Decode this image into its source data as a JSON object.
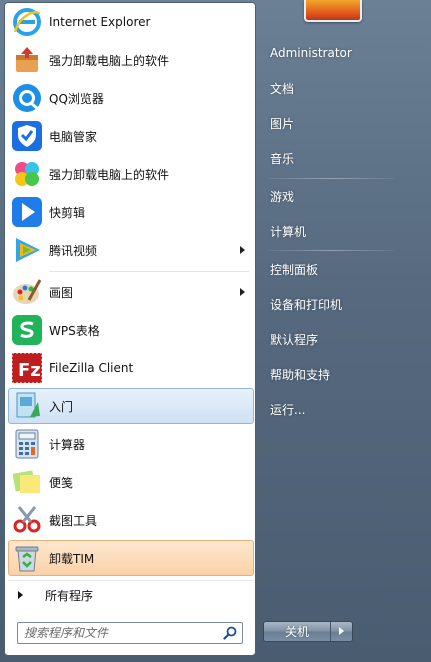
{
  "programs": [
    {
      "label": "Internet Explorer",
      "icon": "internet-explorer-icon",
      "name": "internet-explorer",
      "arrow": false,
      "highlight": ""
    },
    {
      "label": "强力卸载电脑上的软件",
      "icon": "uninstall-box-icon",
      "name": "uninstaller-1",
      "arrow": false,
      "highlight": ""
    },
    {
      "label": "QQ浏览器",
      "icon": "qq-browser-icon",
      "name": "qq-browser",
      "arrow": false,
      "highlight": ""
    },
    {
      "label": "电脑管家",
      "icon": "pc-manager-shield-icon",
      "name": "pc-manager",
      "arrow": false,
      "highlight": ""
    },
    {
      "label": "强力卸载电脑上的软件",
      "icon": "uninstall-flower-icon",
      "name": "uninstaller-2",
      "arrow": false,
      "highlight": ""
    },
    {
      "label": "快剪辑",
      "icon": "kuaijianji-icon",
      "name": "kuaijianji",
      "arrow": false,
      "highlight": ""
    },
    {
      "label": "腾讯视频",
      "icon": "tencent-video-icon",
      "name": "tencent-video",
      "arrow": true,
      "highlight": ""
    },
    {
      "label": "画图",
      "icon": "paint-palette-icon",
      "name": "paint",
      "arrow": true,
      "highlight": ""
    },
    {
      "label": "WPS表格",
      "icon": "wps-spreadsheet-icon",
      "name": "wps-spreadsheet",
      "arrow": false,
      "highlight": ""
    },
    {
      "label": "FileZilla Client",
      "icon": "filezilla-icon",
      "name": "filezilla",
      "arrow": false,
      "highlight": ""
    },
    {
      "label": "入门",
      "icon": "getting-started-icon",
      "name": "getting-started",
      "arrow": false,
      "highlight": "blue"
    },
    {
      "label": "计算器",
      "icon": "calculator-icon",
      "name": "calculator",
      "arrow": false,
      "highlight": ""
    },
    {
      "label": "便笺",
      "icon": "sticky-notes-icon",
      "name": "sticky-notes",
      "arrow": false,
      "highlight": ""
    },
    {
      "label": "截图工具",
      "icon": "snipping-tool-icon",
      "name": "snipping-tool",
      "arrow": false,
      "highlight": ""
    },
    {
      "label": "卸载TIM",
      "icon": "recycle-bin-icon",
      "name": "uninstall-tim",
      "arrow": false,
      "highlight": "orange"
    }
  ],
  "all_programs": "所有程序",
  "search": {
    "placeholder": "搜索程序和文件"
  },
  "right_links": [
    {
      "label": "Administrator",
      "name": "user-folder"
    },
    {
      "label": "文档",
      "name": "documents"
    },
    {
      "label": "图片",
      "name": "pictures"
    },
    {
      "label": "音乐",
      "name": "music"
    },
    {
      "label": "游戏",
      "name": "games"
    },
    {
      "label": "计算机",
      "name": "computer"
    },
    {
      "label": "控制面板",
      "name": "control-panel"
    },
    {
      "label": "设备和打印机",
      "name": "devices-printers"
    },
    {
      "label": "默认程序",
      "name": "default-programs"
    },
    {
      "label": "帮助和支持",
      "name": "help-support"
    },
    {
      "label": "运行...",
      "name": "run"
    }
  ],
  "shutdown_label": "关机",
  "colors": {
    "highlight_blue": "#cfe1f5",
    "highlight_orange": "#fbd2a8",
    "right_panel": "#56697e"
  }
}
